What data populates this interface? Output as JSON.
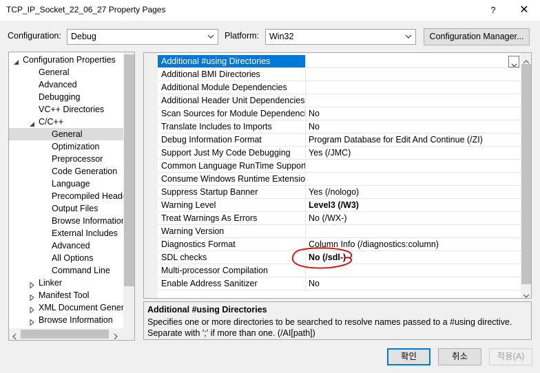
{
  "window": {
    "title": "TCP_IP_Socket_22_06_27 Property Pages",
    "help": "?",
    "close": "✕"
  },
  "config": {
    "config_label": "Configuration:",
    "config_value": "Debug",
    "platform_label": "Platform:",
    "platform_value": "Win32",
    "manager_button": "Configuration Manager..."
  },
  "tree": {
    "items": [
      {
        "label": "Configuration Properties",
        "expanded": true
      },
      {
        "label": "General"
      },
      {
        "label": "Advanced"
      },
      {
        "label": "Debugging"
      },
      {
        "label": "VC++ Directories"
      },
      {
        "label": "C/C++",
        "expanded": true
      },
      {
        "label": "General",
        "selected": true
      },
      {
        "label": "Optimization"
      },
      {
        "label": "Preprocessor"
      },
      {
        "label": "Code Generation"
      },
      {
        "label": "Language"
      },
      {
        "label": "Precompiled Heade"
      },
      {
        "label": "Output Files"
      },
      {
        "label": "Browse Information"
      },
      {
        "label": "External Includes"
      },
      {
        "label": "Advanced"
      },
      {
        "label": "All Options"
      },
      {
        "label": "Command Line"
      },
      {
        "label": "Linker",
        "expanded": false
      },
      {
        "label": "Manifest Tool",
        "expanded": false
      },
      {
        "label": "XML Document Genera",
        "expanded": false
      },
      {
        "label": "Browse Information",
        "expanded": false
      }
    ]
  },
  "grid": {
    "rows": [
      {
        "name": "Additional #using Directories",
        "value": "",
        "selected": true
      },
      {
        "name": "Additional BMI Directories",
        "value": ""
      },
      {
        "name": "Additional Module Dependencies",
        "value": ""
      },
      {
        "name": "Additional Header Unit Dependencies",
        "value": ""
      },
      {
        "name": "Scan Sources for Module Dependencies",
        "value": "No"
      },
      {
        "name": "Translate Includes to Imports",
        "value": "No"
      },
      {
        "name": "Debug Information Format",
        "value": "Program Database for Edit And Continue (/ZI)"
      },
      {
        "name": "Support Just My Code Debugging",
        "value": "Yes (/JMC)"
      },
      {
        "name": "Common Language RunTime Support",
        "value": ""
      },
      {
        "name": "Consume Windows Runtime Extension",
        "value": ""
      },
      {
        "name": "Suppress Startup Banner",
        "value": "Yes (/nologo)"
      },
      {
        "name": "Warning Level",
        "value": "Level3 (/W3)",
        "bold": true
      },
      {
        "name": "Treat Warnings As Errors",
        "value": "No (/WX-)"
      },
      {
        "name": "Warning Version",
        "value": ""
      },
      {
        "name": "Diagnostics Format",
        "value": "Column Info (/diagnostics:column)"
      },
      {
        "name": "SDL checks",
        "value": "No (/sdl-)",
        "bold": true
      },
      {
        "name": "Multi-processor Compilation",
        "value": ""
      },
      {
        "name": "Enable Address Sanitizer",
        "value": "No"
      }
    ]
  },
  "description": {
    "title": "Additional #using Directories",
    "text": "Specifies one or more directories to be searched to resolve names passed to a #using directive. Separate with ';' if more than one. (/AI[path])"
  },
  "buttons": {
    "ok": "확인",
    "cancel": "취소",
    "apply": "적용(A)"
  },
  "colors": {
    "selection": "#0078d7",
    "annotation": "#e00000"
  }
}
